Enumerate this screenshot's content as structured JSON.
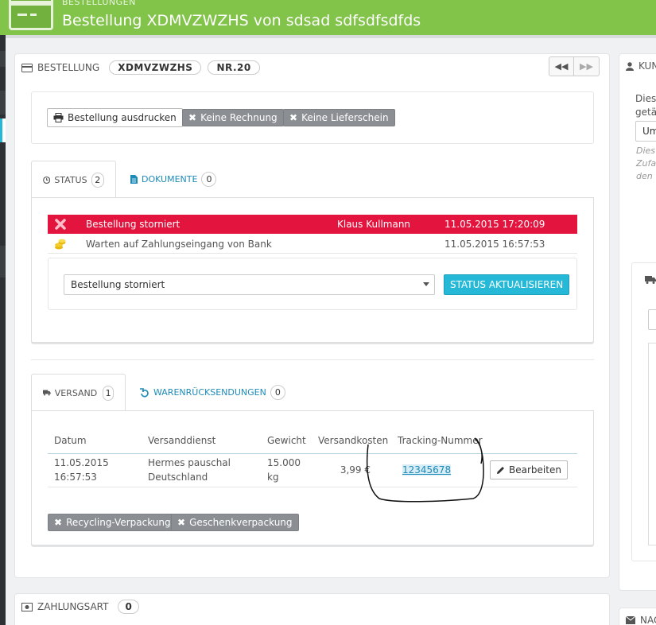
{
  "header": {
    "breadcrumb": "BESTELLUNGEN",
    "title": "Bestellung XDMVZWZHS von sdsad sdfsdfsdfds"
  },
  "order": {
    "label": "BESTELLUNG",
    "reference": "XDMVZWZHS",
    "number": "NR.20"
  },
  "actions": {
    "print": "Bestellung ausdrucken",
    "no_invoice": "Keine Rechnung",
    "no_delivery": "Keine Lieferschein"
  },
  "status_tabs": {
    "status_label": "STATUS",
    "status_count": "2",
    "documents_label": "DOKUMENTE",
    "documents_count": "0"
  },
  "history": [
    {
      "status": "Bestellung storniert",
      "employee": "Klaus Kullmann",
      "date": "11.05.2015 17:20:09"
    },
    {
      "status": "Warten auf Zahlungseingang von Bank",
      "employee": "",
      "date": "11.05.2015 16:57:53"
    }
  ],
  "status_update": {
    "selected": "Bestellung storniert",
    "button": "STATUS AKTUALISIEREN"
  },
  "shipping_tabs": {
    "shipping_label": "VERSAND",
    "shipping_count": "1",
    "returns_label": "WARENRÜCKSENDUNGEN",
    "returns_count": "0"
  },
  "shipping_table": {
    "headers": [
      "Datum",
      "Versanddienst",
      "Gewicht",
      "Versandkosten",
      "Tracking-Nummer"
    ],
    "row": {
      "date_line1": "11.05.2015",
      "date_line2": "16:57:53",
      "carrier_line1": "Hermes pauschal",
      "carrier_line2": "Deutschland",
      "weight_line1": "15.000",
      "weight_line2": "kg",
      "cost": "3,99 €",
      "tracking": "12345678",
      "edit": "Bearbeiten"
    }
  },
  "packaging": {
    "recycling": "Recycling-Verpackung",
    "gift": "Geschenkverpackung"
  },
  "payment": {
    "label": "ZAHLUNGSART",
    "count": "0"
  },
  "right": {
    "customer_label": "KUN",
    "text1": "Dies",
    "text2": "getä",
    "select_value": "Um",
    "note1": "Dies",
    "note2": "Zufa",
    "note3": "den",
    "bottom_label": "NAC"
  },
  "colors": {
    "header_green": "#82c34a",
    "canceled_red": "#e3153e",
    "primary_blue": "#25b9d7",
    "link_blue": "#1d8bb7"
  }
}
